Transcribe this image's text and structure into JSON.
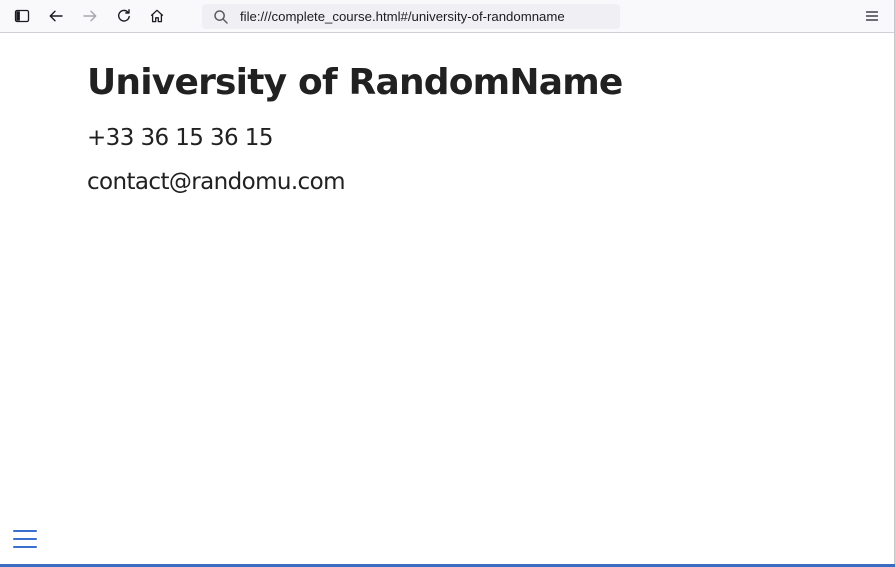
{
  "browser": {
    "url": "file:///complete_course.html#/university-of-randomname",
    "icons": {
      "sidebar": "sidebar-toggle-icon",
      "back": "arrow-left-icon",
      "forward": "arrow-right-icon",
      "reload": "reload-icon",
      "home": "home-icon",
      "search": "search-icon",
      "menu": "menu-icon"
    },
    "forward_enabled": false
  },
  "page": {
    "title": "University of RandomName",
    "phone": "+33 36 15 36 15",
    "email": "contact@randomu.com",
    "nav_toggle_icon": "hamburger-icon"
  },
  "colors": {
    "accent": "#3b6cc4",
    "text": "#212121",
    "toolbar_bg": "#f9f9fb",
    "urlbar_bg": "#f0f0f4"
  }
}
